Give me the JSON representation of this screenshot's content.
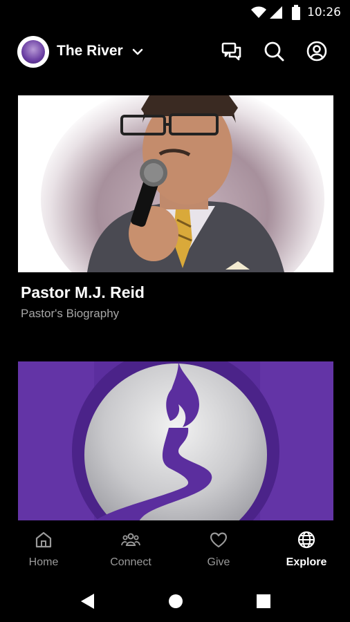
{
  "status_bar": {
    "time": "10:26"
  },
  "header": {
    "church_name": "The River"
  },
  "cards": [
    {
      "title": "Pastor M.J. Reid",
      "subtitle": "Pastor's Biography"
    }
  ],
  "bottom_nav": {
    "items": [
      {
        "label": "Home",
        "icon": "home-icon",
        "active": false
      },
      {
        "label": "Connect",
        "icon": "people-icon",
        "active": false
      },
      {
        "label": "Give",
        "icon": "heart-icon",
        "active": false
      },
      {
        "label": "Explore",
        "icon": "globe-icon",
        "active": true
      }
    ]
  },
  "colors": {
    "background": "#000000",
    "brand_purple": "#5b2e9e",
    "inactive_text": "#9a9a9a"
  }
}
